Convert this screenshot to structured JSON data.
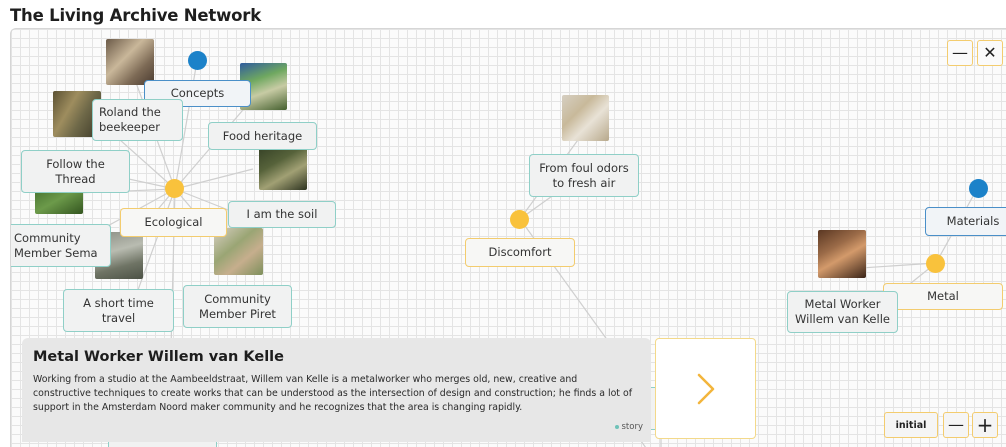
{
  "app": {
    "title": "The Living Archive Network"
  },
  "window_controls": {
    "minimize": "—",
    "close": "✕"
  },
  "nodes": {
    "concepts": "Concepts",
    "roland": "Roland the\nbeekeeper",
    "food_heritage": "Food heritage",
    "follow_thread": "Follow the\nThread",
    "ecological": "Ecological",
    "i_am_the_soil": "I am the soil",
    "community_sema": "Community\nMember Sema",
    "short_time_travel": "A short time\ntravel",
    "community_piret": "Community\nMember Piret",
    "foul_odors": "From foul odors\nto fresh air",
    "discomfort": "Discomfort",
    "materials": "Materials",
    "metal": "Metal",
    "metal_worker": "Metal Worker\nWillem van Kelle",
    "hidden_lower": ""
  },
  "info_panel": {
    "title": "Metal Worker Willem van Kelle",
    "body": "Working from a studio at the Aambeeldstraat, Willem van Kelle is a metalworker who merges old, new, creative and constructive techniques to create works that can be understood as the intersection of design and construction; he finds a lot of support in the Amsterdam Noord maker community and he recognizes that the area is changing rapidly.",
    "tag": "story"
  },
  "next_button": {
    "icon": "chevron-right-icon"
  },
  "zoom": {
    "initial_label": "initial",
    "zoom_out": "—",
    "zoom_in": "+"
  },
  "colors": {
    "yellow_node": "#f9c23c",
    "blue_node": "#1c82c9",
    "teal_border": "#8fcfc7",
    "yellow_border": "#f3cc6e"
  }
}
